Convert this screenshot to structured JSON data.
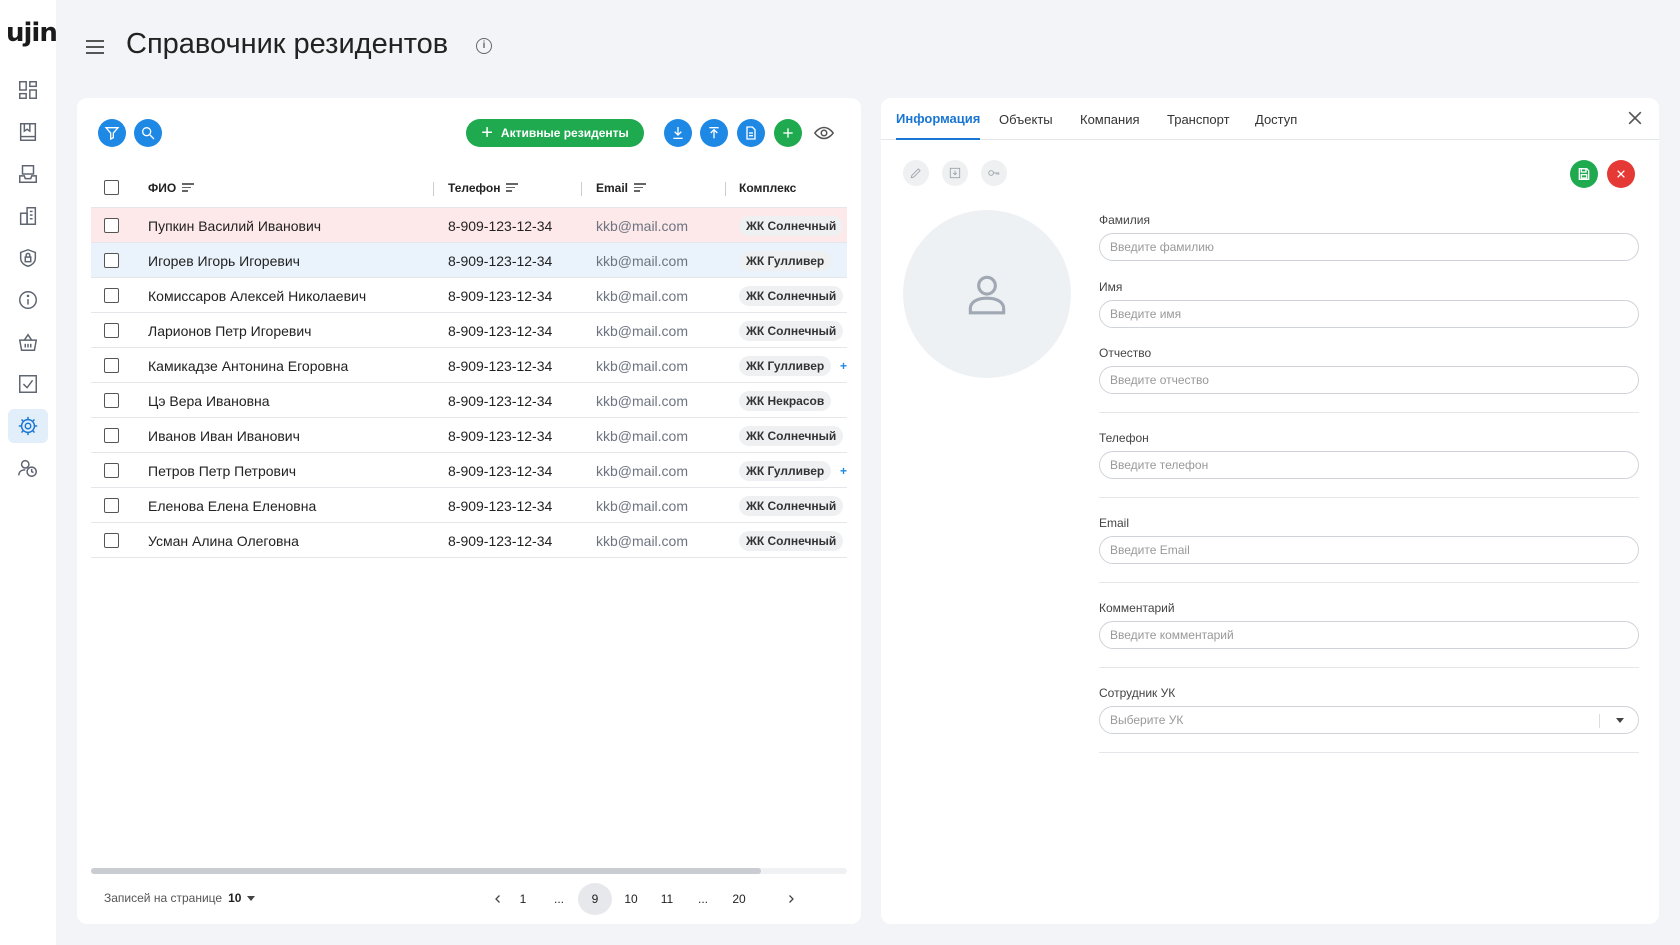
{
  "app": {
    "logo": "ujin",
    "title": "Справочник резидентов"
  },
  "toolbar": {
    "active_residents_label": "Активные резиденты"
  },
  "table": {
    "columns": {
      "name": "ФИО",
      "phone": "Телефон",
      "email": "Email",
      "complex": "Комплекс"
    },
    "rows": [
      {
        "name": "Пупкин Василий Иванович",
        "phone": "8-909-123-12-34",
        "email": "kkb@mail.com",
        "complex": "ЖК Солнечный",
        "extra": ""
      },
      {
        "name": "Игорев Игорь Игоревич",
        "phone": "8-909-123-12-34",
        "email": "kkb@mail.com",
        "complex": "ЖК Гулливер",
        "extra": ""
      },
      {
        "name": "Комиссаров Алексей Николаевич",
        "phone": "8-909-123-12-34",
        "email": "kkb@mail.com",
        "complex": "ЖК Солнечный",
        "extra": ""
      },
      {
        "name": "Ларионов Петр Игоревич",
        "phone": "8-909-123-12-34",
        "email": "kkb@mail.com",
        "complex": "ЖК Солнечный",
        "extra": ""
      },
      {
        "name": "Камикадзе Антонина Егоровна",
        "phone": "8-909-123-12-34",
        "email": "kkb@mail.com",
        "complex": "ЖК Гулливер",
        "extra": "+"
      },
      {
        "name": "Цэ Вера Ивановна",
        "phone": "8-909-123-12-34",
        "email": "kkb@mail.com",
        "complex": "ЖК Некрасов",
        "extra": ""
      },
      {
        "name": "Иванов Иван Иванович",
        "phone": "8-909-123-12-34",
        "email": "kkb@mail.com",
        "complex": "ЖК Солнечный",
        "extra": ""
      },
      {
        "name": "Петров Петр Петрович",
        "phone": "8-909-123-12-34",
        "email": "kkb@mail.com",
        "complex": "ЖК Гулливер",
        "extra": "+"
      },
      {
        "name": "Еленова Елена Еленовна",
        "phone": "8-909-123-12-34",
        "email": "kkb@mail.com",
        "complex": "ЖК Солнечный",
        "extra": ""
      },
      {
        "name": "Усман Алина Олеговна",
        "phone": "8-909-123-12-34",
        "email": "kkb@mail.com",
        "complex": "ЖК Солнечный",
        "extra": ""
      }
    ]
  },
  "pagination": {
    "per_page_label": "Записей на странице",
    "per_page_value": "10",
    "pages": [
      "1",
      "...",
      "9",
      "10",
      "11",
      "...",
      "20"
    ],
    "current": "9"
  },
  "detail": {
    "tabs": [
      "Информация",
      "Объекты",
      "Компания",
      "Транспорт",
      "Доступ"
    ],
    "fields": {
      "last_name": {
        "label": "Фамилия",
        "placeholder": "Введите фамилию"
      },
      "first_name": {
        "label": "Имя",
        "placeholder": "Введите имя"
      },
      "middle_name": {
        "label": "Отчество",
        "placeholder": "Введите отчество"
      },
      "phone": {
        "label": "Телефон",
        "placeholder": "Введите телефон"
      },
      "email": {
        "label": "Email",
        "placeholder": "Введите Email"
      },
      "comment": {
        "label": "Комментарий",
        "placeholder": "Введите комментарий"
      },
      "employee": {
        "label": "Сотрудник УК",
        "placeholder": "Выберите УК"
      }
    }
  },
  "colors": {
    "accent": "#1e88e5",
    "success": "#1faa4f",
    "danger": "#e53935",
    "row_highlight": "#fde8ea",
    "row_selected": "#eaf3fc"
  }
}
